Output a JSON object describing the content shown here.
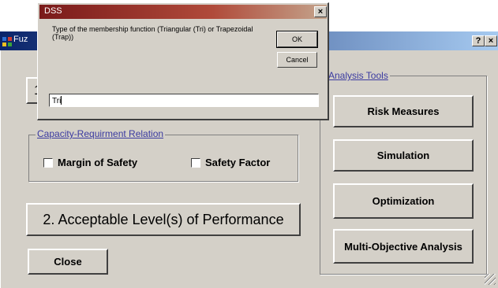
{
  "main_window": {
    "title": "Fuz",
    "help_glyph": "?",
    "close_glyph": "×",
    "step1_label": "1",
    "capacity_group": {
      "title": "Capacity-Requirment Relation",
      "margin_label": "Margin of Safety",
      "factor_label": "Safety Factor"
    },
    "step2_label": "2. Acceptable Level(s) of Performance",
    "close_label": "Close",
    "analysis_group": {
      "title": "Analysis Tools",
      "buttons": [
        "Risk Measures",
        "Simulation",
        "Optimization",
        "Multi-Objective Analysis"
      ]
    }
  },
  "dialog": {
    "title": "DSS",
    "close_glyph": "×",
    "message": "Type of the membership function (Triangular (Tri) or Trapezoidal (Trap))",
    "ok_label": "OK",
    "cancel_label": "Cancel",
    "input_value": "Tri"
  },
  "colors": {
    "window_face": "#d4d0c8",
    "dialog_title_start": "#7a1a1a",
    "group_label": "#3a3aa0"
  }
}
